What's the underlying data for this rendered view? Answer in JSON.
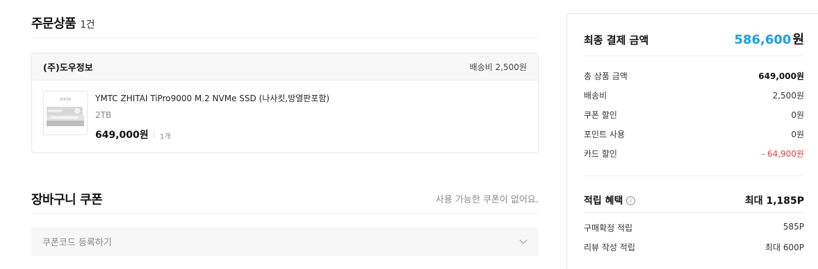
{
  "order": {
    "title": "주문상품",
    "count": "1건",
    "seller": "(주)도우정보",
    "shipping_fee": "배송비 2,500원",
    "product": {
      "name": "YMTC ZHITAI TiPro9000 M.2 NVMe SSD (나사킷,방열판포함)",
      "option": "2TB",
      "price": "649,000원",
      "quantity": "1개",
      "thumb_brand": "ZHITAI"
    }
  },
  "coupon": {
    "title": "장바구니 쿠폰",
    "note": "사용 가능한 쿠폰이 없어요.",
    "register_label": "쿠폰코드 등록하기"
  },
  "summary": {
    "final_label": "최종 결제 금액",
    "final_amount": "586,600",
    "final_unit": "원",
    "rows": [
      {
        "label": "총 상품 금액",
        "value": "649,000원"
      },
      {
        "label": "배송비",
        "value": "2,500원"
      },
      {
        "label": "쿠폰 할인",
        "value": "0원"
      },
      {
        "label": "포인트 사용",
        "value": "0원"
      },
      {
        "label": "카드 할인",
        "value": "- 64,900원"
      }
    ],
    "reward_label": "적립 혜택",
    "reward_value": "최대 1,185P",
    "reward_rows": [
      {
        "label": "구매확정 적립",
        "value": "585P"
      },
      {
        "label": "리뷰 작성 적립",
        "value": "최대 600P"
      }
    ]
  },
  "colors": {
    "accent": "#1a9ee6",
    "discount": "#ee3b3b"
  }
}
